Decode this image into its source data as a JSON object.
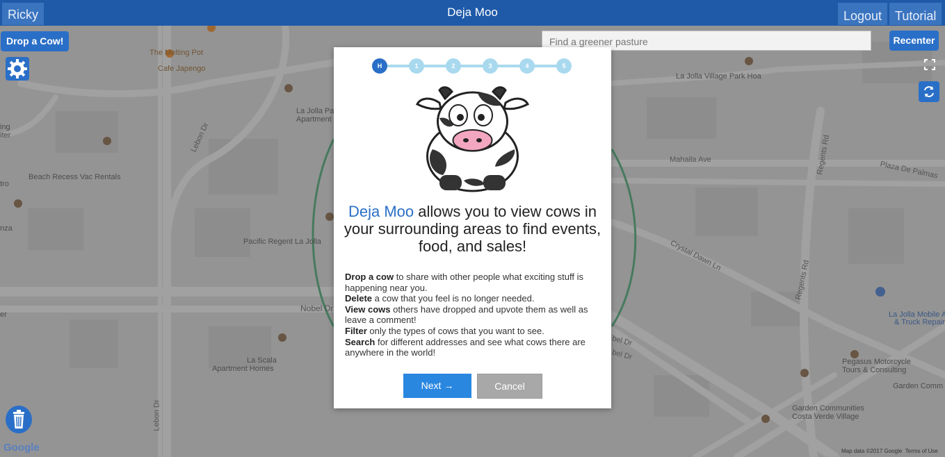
{
  "header": {
    "user": "Ricky",
    "title": "Deja Moo",
    "logout_label": "Logout",
    "tutorial_label": "Tutorial"
  },
  "map_controls": {
    "drop_cow_label": "Drop a Cow!",
    "recenter_label": "Recenter",
    "search_placeholder": "Find a greener pasture"
  },
  "map_labels": {
    "melting_pot": "The Melting Pot",
    "cafe_japengo": "Cafe Japengo",
    "la_jolla_pa": "La Jolla Pa",
    "apartment": "Apartment",
    "lebon_dr": "Lebon Dr",
    "lebon_dr_2": "Lebon Dr",
    "beach_recess": "Beach Recess Vac Rentals",
    "tro": "tro",
    "nza": "nza",
    "ing": "ing",
    "iter": "iter",
    "pacific_regent": "Pacific Regent La Jolla",
    "nobel_dr": "Nobel Dr",
    "la_scala_1": "La Scala",
    "la_scala_2": "Apartment Homes",
    "village_park": "La Jolla Village Park Hoa",
    "mahaila": "Mahaila Ave",
    "plaza": "Plaza De Palmas",
    "regents_rd": "Regents Rd",
    "regents_rd_2": "Regents Rd",
    "crystal_dawn": "Crystal Dawn Ln",
    "mobile_1": "La Jolla Mobile A",
    "mobile_2": "& Truck Repair",
    "pegasus_1": "Pegasus Motorcycle",
    "pegasus_2": "Tours & Consulting",
    "garden_comm": "Garden Comm",
    "garden_communities_1": "Garden Communities",
    "garden_communities_2": "Costa Verde Village",
    "bel_dr": "bel Dr",
    "bel_dr_2": "bel Dr",
    "er": "er"
  },
  "footer": {
    "google": "Google",
    "map_data": "Map data ©2017 Google",
    "terms": "Terms of Use"
  },
  "tutorial": {
    "steps": [
      "H",
      "1",
      "2",
      "3",
      "4",
      "5"
    ],
    "active_step": 0,
    "headline_brand": "Deja Moo",
    "headline_rest": " allows you to view cows in your surrounding areas to find events, food, and sales!",
    "items": [
      {
        "bold": "Drop a cow",
        "text": " to share with other people what exciting stuff is happening near you."
      },
      {
        "bold": "Delete",
        "text": " a cow that you feel is no longer needed."
      },
      {
        "bold": "View cows",
        "text": " others have dropped and upvote them as well as leave a comment!"
      },
      {
        "bold": "Filter",
        "text": " only the types of cows that you want to see."
      },
      {
        "bold": "Search",
        "text": " for different addresses and see what cows there are anywhere in the world!"
      }
    ],
    "next_label": "Next →",
    "cancel_label": "Cancel"
  },
  "colors": {
    "header": "#1e5aa8",
    "accent": "#2a6fc7",
    "next": "#2a87e0",
    "step_inactive": "#a9d9ee",
    "cancel": "#a8a8a8"
  },
  "icons": {
    "settings": "gear-icon",
    "refresh": "refresh-icon",
    "fullscreen": "fullscreen-icon",
    "trash": "trash-icon"
  }
}
